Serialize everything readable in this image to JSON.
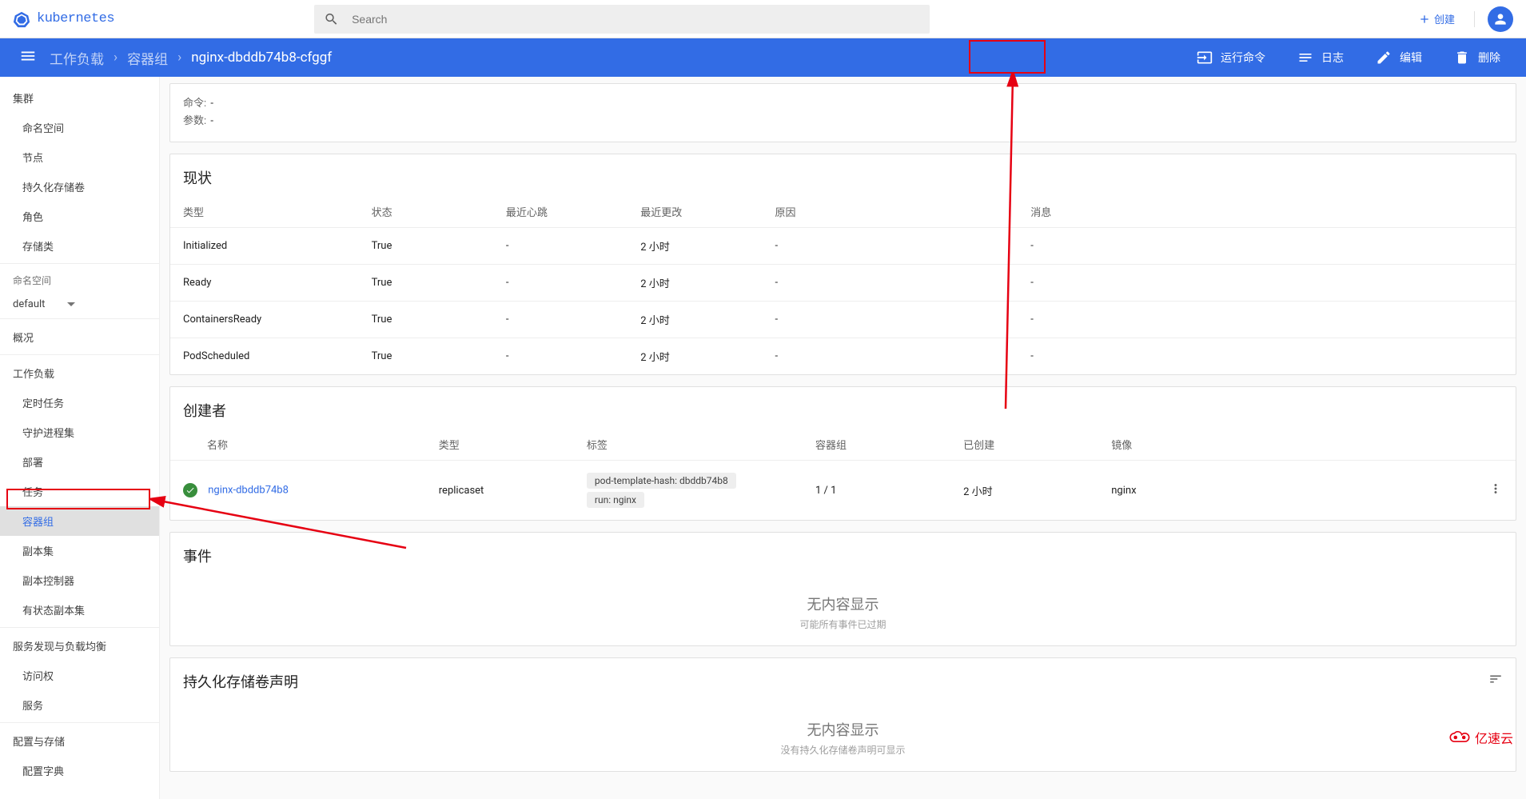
{
  "header": {
    "logo_text": "kubernetes",
    "search_placeholder": "Search",
    "create_label": "创建"
  },
  "breadcrumb": {
    "items": [
      "工作负载",
      "容器组",
      "nginx-dbddb74b8-cfggf"
    ]
  },
  "actions": {
    "exec": "运行命令",
    "logs": "日志",
    "edit": "编辑",
    "delete": "删除"
  },
  "sidebar": {
    "cluster": "集群",
    "namespaces": "命名空间",
    "nodes": "节点",
    "pv": "持久化存储卷",
    "roles": "角色",
    "storage_classes": "存储类",
    "ns_label": "命名空间",
    "ns_selected": "default",
    "overview": "概况",
    "workloads": "工作负载",
    "cronjobs": "定时任务",
    "daemonsets": "守护进程集",
    "deployments": "部署",
    "jobs": "任务",
    "pods": "容器组",
    "replicasets": "副本集",
    "rc": "副本控制器",
    "statefulsets": "有状态副本集",
    "discovery": "服务发现与负载均衡",
    "ingresses": "访问权",
    "services": "服务",
    "config": "配置与存储",
    "configmaps": "配置字典"
  },
  "info_card": {
    "cmd_label": "命令:",
    "cmd_value": "-",
    "args_label": "参数:",
    "args_value": "-"
  },
  "status_card": {
    "title": "现状",
    "headers": [
      "类型",
      "状态",
      "最近心跳",
      "最近更改",
      "原因",
      "消息"
    ],
    "rows": [
      [
        "Initialized",
        "True",
        "-",
        "2 小时",
        "-",
        "-"
      ],
      [
        "Ready",
        "True",
        "-",
        "2 小时",
        "-",
        "-"
      ],
      [
        "ContainersReady",
        "True",
        "-",
        "2 小时",
        "-",
        "-"
      ],
      [
        "PodScheduled",
        "True",
        "-",
        "2 小时",
        "-",
        "-"
      ]
    ]
  },
  "creator_card": {
    "title": "创建者",
    "headers": [
      "名称",
      "类型",
      "标签",
      "容器组",
      "已创建",
      "镜像"
    ],
    "row": {
      "name": "nginx-dbddb74b8",
      "type": "replicaset",
      "labels": [
        "pod-template-hash: dbddb74b8",
        "run: nginx"
      ],
      "pods": "1 / 1",
      "created": "2 小时",
      "image": "nginx"
    }
  },
  "events_card": {
    "title": "事件",
    "empty_title": "无内容显示",
    "empty_sub": "可能所有事件已过期"
  },
  "pvc_card": {
    "title": "持久化存储卷声明",
    "empty_title": "无内容显示",
    "empty_sub": "没有持久化存储卷声明可显示"
  },
  "watermark": "亿速云"
}
